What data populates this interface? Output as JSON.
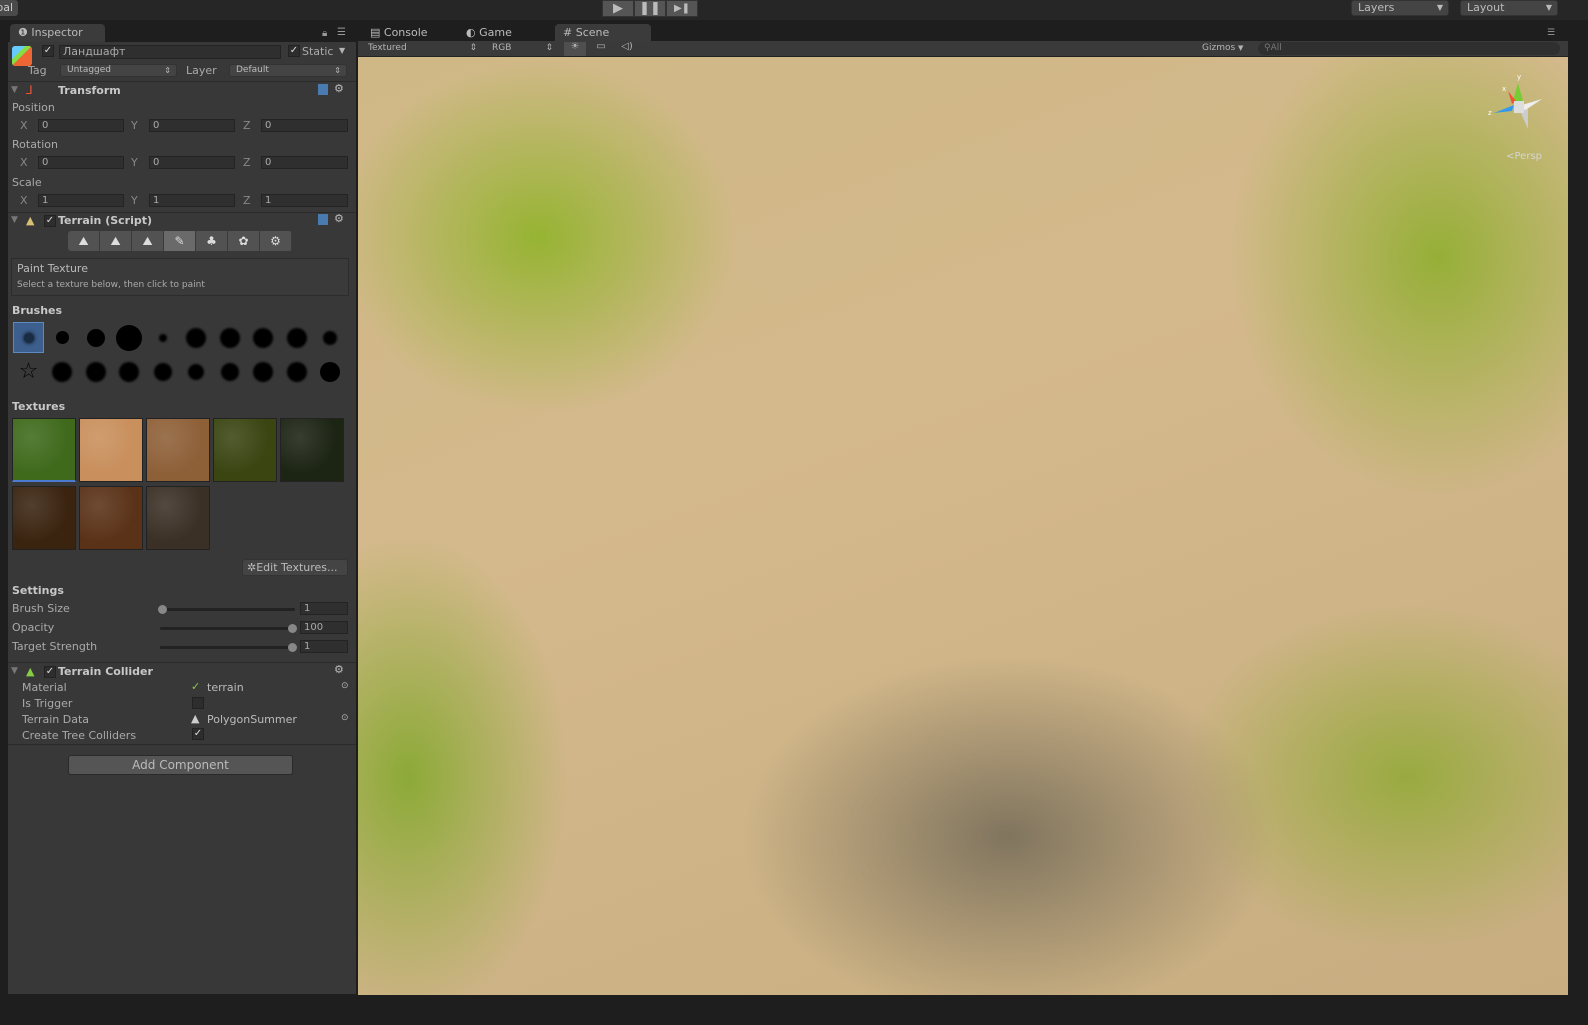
{
  "toolbar": {
    "global_label": "Global",
    "play": "▶",
    "pause": "❚❚",
    "step": "▶❚",
    "layers": "Layers",
    "layout": "Layout"
  },
  "inspector": {
    "tab": "Inspector",
    "object_name": "Ландшафт",
    "static_label": "Static",
    "tag_label": "Tag",
    "tag_value": "Untagged",
    "layer_label": "Layer",
    "layer_value": "Default",
    "transform": {
      "title": "Transform",
      "position_label": "Position",
      "rotation_label": "Rotation",
      "scale_label": "Scale",
      "axes": [
        "X",
        "Y",
        "Z"
      ],
      "position": [
        "0",
        "0",
        "0"
      ],
      "rotation": [
        "0",
        "0",
        "0"
      ],
      "scale": [
        "1",
        "1",
        "1"
      ]
    },
    "terrain": {
      "title": "Terrain (Script)",
      "mode_title": "Paint Texture",
      "mode_hint": "Select a texture below, then click to paint",
      "brushes_label": "Brushes",
      "textures_label": "Textures",
      "edit_textures": "Edit Textures...",
      "settings_label": "Settings",
      "settings": [
        {
          "label": "Brush Size",
          "value": "1",
          "fraction": 0.0
        },
        {
          "label": "Opacity",
          "value": "100",
          "fraction": 1.0
        },
        {
          "label": "Target Strength",
          "value": "1",
          "fraction": 1.0
        }
      ],
      "textures": [
        "#3f6a1c",
        "#c98f5c",
        "#8e6038",
        "#3a4512",
        "#1c2414",
        "#3a2410",
        "#5a3218",
        "#3b3026"
      ]
    },
    "collider": {
      "title": "Terrain Collider",
      "rows": [
        {
          "label": "Material",
          "value": "terrain"
        },
        {
          "label": "Is Trigger",
          "value": ""
        },
        {
          "label": "Terrain Data",
          "value": "PolygonSummer"
        },
        {
          "label": "Create Tree Colliders",
          "value": ""
        }
      ]
    },
    "add_component": "Add Component"
  },
  "scene": {
    "tabs": [
      "Console",
      "Game",
      "Scene"
    ],
    "render_mode": "Textured",
    "channel": "RGB",
    "gizmos": "Gizmos",
    "search_placeholder": "All",
    "persp": "Persp",
    "gizmo_axes": [
      "y",
      "x",
      "z"
    ]
  }
}
